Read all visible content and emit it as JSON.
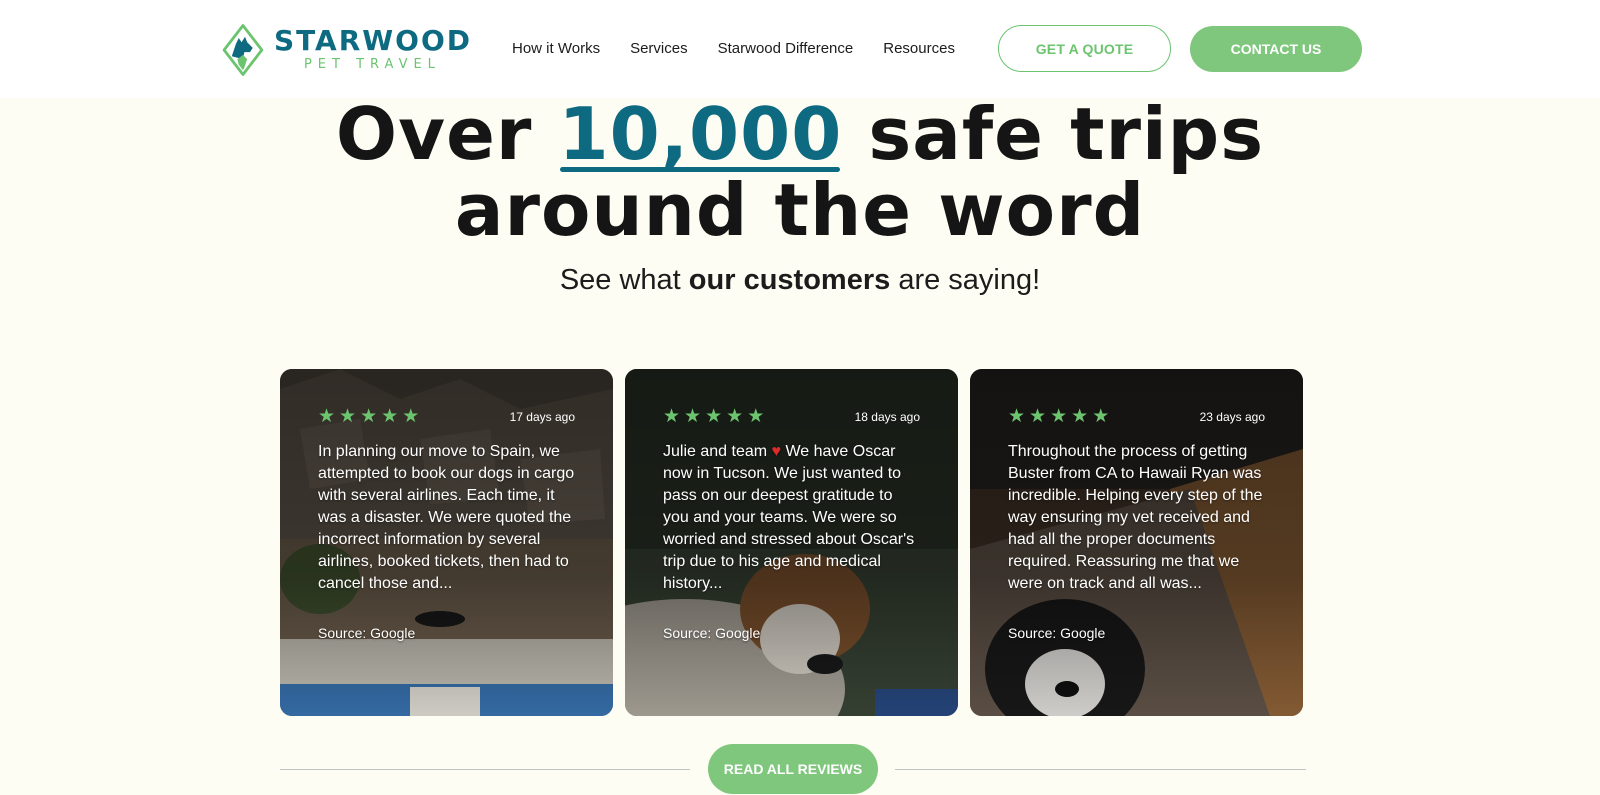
{
  "brand": {
    "name": "STARWOOD",
    "tagline": "PET TRAVEL",
    "primary_color": "#0e6a80",
    "accent_color": "#6cc46f"
  },
  "nav": {
    "items": [
      "How it Works",
      "Services",
      "Starwood Difference",
      "Resources"
    ]
  },
  "header": {
    "quote_button": "GET A QUOTE",
    "contact_button": "CONTACT US"
  },
  "hero": {
    "title_prefix": "Over",
    "title_highlight": "10,000",
    "title_suffix": "safe trips",
    "title_line2": "around the word",
    "subtitle_before": "See what",
    "subtitle_bold": "our customers",
    "subtitle_after": "are saying!"
  },
  "reviews": [
    {
      "rating": 5,
      "date": "17 days ago",
      "text": "In planning our move to Spain, we attempted to book our dogs in cargo with several airlines. Each time, it was a disaster. We were quoted the incorrect information by several airlines, booked tickets, then had to cancel those and...",
      "source": "Source: Google"
    },
    {
      "rating": 5,
      "date": "18 days ago",
      "text_before_icon": "Julie and team",
      "text": "We have Oscar now in Tucson. We just wanted to pass on our deepest gratitude to you and your teams. We were so worried and stressed about Oscar's trip due to his age and medical history...",
      "icon": "heart-icon",
      "source": "Source: Google"
    },
    {
      "rating": 5,
      "date": "23 days ago",
      "text": "Throughout the process of getting Buster from CA to Hawaii Ryan was incredible. Helping every step of the way ensuring my vet received and had all the proper documents required. Reassuring me that we were on track and all was...",
      "source": "Source: Google"
    }
  ],
  "footer": {
    "reviews_button": "READ ALL REVIEWS"
  }
}
